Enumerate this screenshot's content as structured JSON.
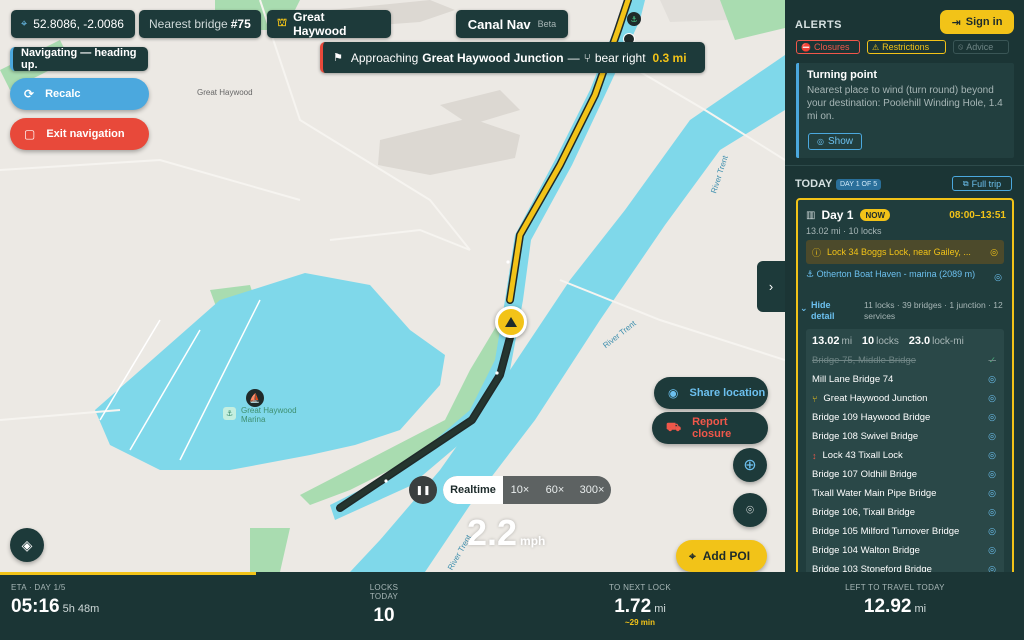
{
  "top": {
    "coords": "52.8086, -2.0086",
    "nearest_prefix": "Nearest bridge",
    "nearest_value": "#75",
    "location": "Great Haywood",
    "app_name": "Canal Nav",
    "app_tag": "Beta"
  },
  "nav": {
    "hint": "Navigating — heading up.",
    "banner_prefix": "Approaching",
    "banner_place": "Great Haywood Junction",
    "banner_dash": "—",
    "banner_action": "bear right",
    "banner_distance": "0.3 mi",
    "recalc": "Recalc",
    "exit": "Exit navigation"
  },
  "map_labels": {
    "town": "Great Haywood",
    "marina": "Great Haywood Marina",
    "river1": "River Trent",
    "river2": "River Trent",
    "river3": "River Trent"
  },
  "actions": {
    "share": "Share location",
    "report": "Report closure",
    "add_poi": "Add POI"
  },
  "sim": {
    "realtime": "Realtime",
    "s1": "10×",
    "s2": "60×",
    "s3": "300×"
  },
  "speed": {
    "value": "2.2",
    "unit": "mph"
  },
  "sidebar": {
    "alerts_title": "ALERTS",
    "sign_in": "Sign in",
    "filters": {
      "closures": "Closures",
      "restrictions": "Restrictions",
      "advice": "Advice"
    },
    "turning": {
      "title": "Turning point",
      "desc": "Nearest place to wind (turn round) beyond your destination: Poolehill Winding Hole, 1.4 mi on.",
      "show": "Show"
    },
    "today_title": "TODAY",
    "day_badge": "DAY 1 OF 5",
    "full_trip": "Full trip",
    "day": {
      "title": "Day 1",
      "now": "NOW",
      "time": "08:00–13:51",
      "summary": "13.02 mi · 10 locks",
      "lock_row": "Lock 34 Boggs Lock, near Gailey, ...",
      "haven": "Otherton Boat Haven - marina (2089 m)",
      "hide": "Hide detail",
      "hide_summary": "11 locks · 39 bridges · 1 junction · 12 services",
      "stats": {
        "mi": "13.02",
        "mi_u": "mi",
        "locks": "10",
        "locks_u": "locks",
        "lockmi": "23.0",
        "lockmi_u": "lock-mi"
      },
      "points": [
        "Bridge 75, Middle Bridge",
        "Mill Lane Bridge 74",
        "Great Haywood Junction",
        "Bridge 109 Haywood Bridge",
        "Bridge 108 Swivel Bridge",
        "Lock 43 Tixall Lock",
        "Bridge 107 Oldhill Bridge",
        "Tixall Water Main Pipe Bridge",
        "Bridge 106, Tixall Bridge",
        "Bridge 105 Milford Turnover Bridge",
        "Bridge 104 Walton Bridge",
        "Bridge 103 Stoneford Bridge"
      ]
    }
  },
  "bottom": {
    "progress": 0.25,
    "eta_label": "ETA · DAY 1/5",
    "eta_value": "05:16",
    "eta_extra": "5h 48m",
    "locks_label": "LOCKS TODAY",
    "locks_value": "10",
    "next_label": "TO NEXT LOCK",
    "next_value": "1.72",
    "next_unit": "mi",
    "next_extra": "~29 min",
    "left_label": "LEFT TO TRAVEL TODAY",
    "left_value": "12.92",
    "left_unit": "mi"
  },
  "colors": {
    "accent": "#f2c318",
    "panel": "#1b3535",
    "water": "#7fd8ea",
    "info": "#4ba8de",
    "danger": "#e8493a"
  },
  "icons": [
    "crosshair-icon",
    "bridge-icon",
    "flag-icon",
    "fork-icon",
    "refresh-icon",
    "square-icon",
    "layers-icon",
    "wifi-icon",
    "truck-icon",
    "target-icon",
    "pin-icon",
    "login-icon",
    "alert-icon",
    "warning-icon",
    "anchor-icon",
    "boat-icon",
    "map-icon",
    "external-icon",
    "chevron-right-icon",
    "pause-icon"
  ]
}
